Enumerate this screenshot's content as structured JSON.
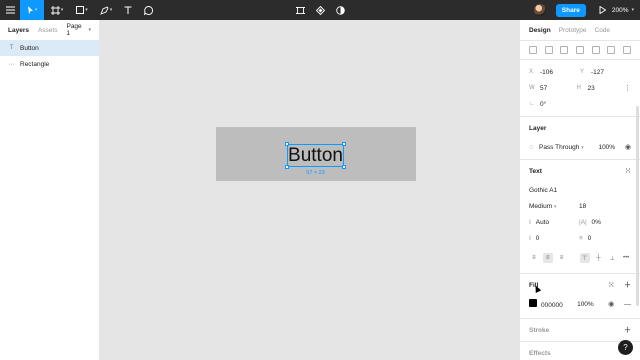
{
  "toolbar": {
    "zoom": "200%",
    "share_label": "Share"
  },
  "left_panel": {
    "tabs": [
      "Layers",
      "Assets"
    ],
    "page": "Page 1",
    "layers": [
      {
        "name": "Button",
        "type": "text",
        "selected": true
      },
      {
        "name": "Rectangle",
        "type": "rectangle",
        "selected": false
      }
    ]
  },
  "canvas": {
    "text_content": "Button",
    "dims_label": "57 × 23",
    "frame_color": "#bdbdbd",
    "selection_color": "#0d99ff"
  },
  "right_panel": {
    "tabs": [
      "Design",
      "Prototype",
      "Code"
    ],
    "position": {
      "x_label": "X",
      "x": "-106",
      "y_label": "Y",
      "y": "-127"
    },
    "size": {
      "w_label": "W",
      "w": "57",
      "h_label": "H",
      "h": "23"
    },
    "rotation": "0°",
    "layer": {
      "title": "Layer",
      "blend": "Pass Through",
      "opacity": "100%"
    },
    "text": {
      "title": "Text",
      "font": "Gothic A1",
      "weight": "Medium",
      "size": "18",
      "line_height": "Auto",
      "letter_spacing": "0%",
      "paragraph_spacing": "0",
      "paragraph_indent": "0"
    },
    "fill": {
      "title": "Fill",
      "hex": "000000",
      "opacity": "100%",
      "color": "#000000"
    },
    "stroke": {
      "title": "Stroke"
    },
    "effects": {
      "title": "Effects"
    }
  },
  "help_label": "?"
}
